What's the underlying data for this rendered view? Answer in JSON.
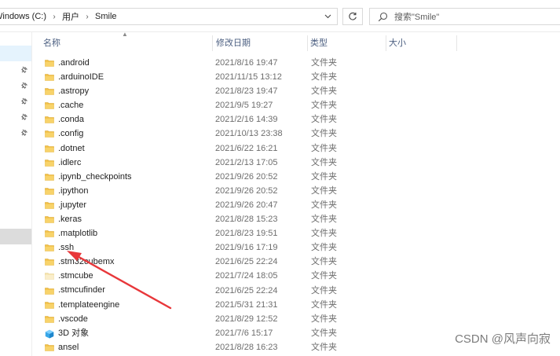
{
  "address_bar": {
    "crumbs": [
      "Windows (C:)",
      "用户",
      "Smile"
    ],
    "separator_icon": "chevron-right-icon",
    "dropdown_icon": "chevron-down-icon"
  },
  "refresh_icon": "refresh-icon",
  "search": {
    "placeholder": "搜索\"Smile\"",
    "icon": "search-icon"
  },
  "columns": {
    "name": "名称",
    "date": "修改日期",
    "type": "类型",
    "size": "大小"
  },
  "files": [
    {
      "name": ".android",
      "date": "2021/8/16 19:47",
      "type": "文件夹",
      "icon": "folder-icon"
    },
    {
      "name": ".arduinoIDE",
      "date": "2021/11/15 13:12",
      "type": "文件夹",
      "icon": "folder-icon"
    },
    {
      "name": ".astropy",
      "date": "2021/8/23 19:47",
      "type": "文件夹",
      "icon": "folder-icon"
    },
    {
      "name": ".cache",
      "date": "2021/9/5 19:27",
      "type": "文件夹",
      "icon": "folder-icon"
    },
    {
      "name": ".conda",
      "date": "2021/2/16 14:39",
      "type": "文件夹",
      "icon": "folder-icon"
    },
    {
      "name": ".config",
      "date": "2021/10/13 23:38",
      "type": "文件夹",
      "icon": "folder-icon"
    },
    {
      "name": ".dotnet",
      "date": "2021/6/22 16:21",
      "type": "文件夹",
      "icon": "folder-icon"
    },
    {
      "name": ".idlerc",
      "date": "2021/2/13 17:05",
      "type": "文件夹",
      "icon": "folder-icon"
    },
    {
      "name": ".ipynb_checkpoints",
      "date": "2021/9/26 20:52",
      "type": "文件夹",
      "icon": "folder-icon"
    },
    {
      "name": ".ipython",
      "date": "2021/9/26 20:52",
      "type": "文件夹",
      "icon": "folder-icon"
    },
    {
      "name": ".jupyter",
      "date": "2021/9/26 20:47",
      "type": "文件夹",
      "icon": "folder-icon"
    },
    {
      "name": ".keras",
      "date": "2021/8/28 15:23",
      "type": "文件夹",
      "icon": "folder-icon"
    },
    {
      "name": ".matplotlib",
      "date": "2021/8/23 19:51",
      "type": "文件夹",
      "icon": "folder-icon"
    },
    {
      "name": ".ssh",
      "date": "2021/9/16 17:19",
      "type": "文件夹",
      "icon": "folder-icon"
    },
    {
      "name": ".stm32cubemx",
      "date": "2021/6/25 22:24",
      "type": "文件夹",
      "icon": "folder-icon"
    },
    {
      "name": ".stmcube",
      "date": "2021/7/24 18:05",
      "type": "文件夹",
      "icon": "folder-light-icon"
    },
    {
      "name": ".stmcufinder",
      "date": "2021/6/25 22:24",
      "type": "文件夹",
      "icon": "folder-icon"
    },
    {
      "name": ".templateengine",
      "date": "2021/5/31 21:31",
      "type": "文件夹",
      "icon": "folder-icon"
    },
    {
      "name": ".vscode",
      "date": "2021/8/29 12:52",
      "type": "文件夹",
      "icon": "folder-icon"
    },
    {
      "name": "3D 对象",
      "date": "2021/7/6 15:17",
      "type": "文件夹",
      "icon": "3d-objects-icon"
    },
    {
      "name": "ansel",
      "date": "2021/8/28 16:23",
      "type": "文件夹",
      "icon": "folder-icon"
    }
  ],
  "annotation": {
    "color": "#e8373a",
    "target": ".ssh"
  },
  "watermark": "CSDN @风声向寂",
  "colors": {
    "folder": "#f3c24a",
    "header_text": "#4d6082",
    "selection": "#e5f3fd"
  }
}
